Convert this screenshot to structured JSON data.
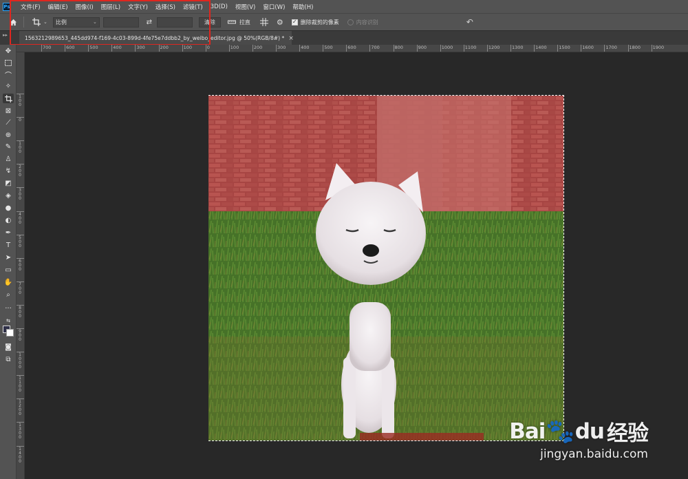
{
  "app": {
    "logo": "Ps"
  },
  "menu": [
    "文件(F)",
    "编辑(E)",
    "图像(I)",
    "图层(L)",
    "文字(Y)",
    "选择(S)",
    "滤镜(T)",
    "3D(D)",
    "视图(V)",
    "窗口(W)",
    "帮助(H)"
  ],
  "options": {
    "ratio_select": "比例",
    "clear_label": "清除",
    "straighten_label": "拉直",
    "delete_cropped_label": "删除裁剪的像素",
    "delete_cropped_checked": true,
    "content_aware_label": "内容识别"
  },
  "document": {
    "tab_title": "1563212989653_445dd974-f169-4c03-899d-4fe75e7ddbb2_by_weibo_editor.jpg @ 50%(RGB/8#) *",
    "close_symbol": "×"
  },
  "ruler": {
    "top": [
      "700",
      "600",
      "500",
      "400",
      "300",
      "200",
      "100",
      "0",
      "100",
      "200",
      "300",
      "400",
      "500",
      "600",
      "700",
      "800",
      "900",
      "1000",
      "1100",
      "1200",
      "1300",
      "1400",
      "1500",
      "1600",
      "1700",
      "1800",
      "1900"
    ],
    "left": [
      "100",
      "0",
      "100",
      "200",
      "300",
      "400",
      "500",
      "600",
      "700",
      "800",
      "900",
      "1000",
      "1100",
      "1200",
      "1300",
      "1400"
    ]
  },
  "watermark": {
    "brand_left": "Bai",
    "brand_mid": "du",
    "brand_right": "经验",
    "url": "jingyan.baidu.com"
  }
}
